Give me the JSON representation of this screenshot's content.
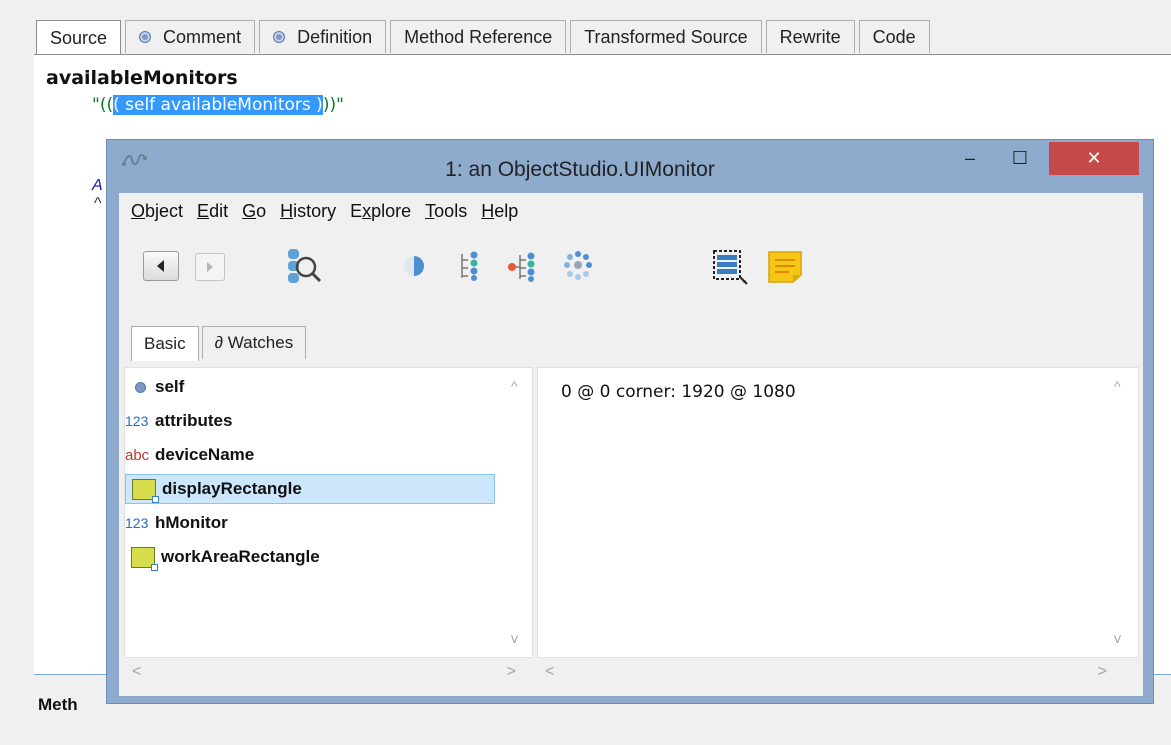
{
  "background_browser": {
    "tabs": [
      {
        "label": "Source",
        "dot": false,
        "active": true
      },
      {
        "label": "Comment",
        "dot": true
      },
      {
        "label": "Definition",
        "dot": true
      },
      {
        "label": "Method Reference",
        "dot": false
      },
      {
        "label": "Transformed Source",
        "dot": false
      },
      {
        "label": "Rewrite",
        "dot": false
      },
      {
        "label": "Code",
        "dot": false
      }
    ],
    "code": {
      "selector": "availableMonitors",
      "comment_prefix": "\"((",
      "comment_selected": "( self availableMonitors )",
      "comment_suffix": "))\"",
      "fragment_a": "A",
      "fragment_b": "^"
    },
    "bottom_label": "Meth"
  },
  "inspector": {
    "title": "1: an ObjectStudio.UIMonitor",
    "window_buttons": {
      "minimize": "–",
      "maximize": "☐",
      "close": "✕"
    },
    "menu": [
      {
        "pre": "",
        "u": "O",
        "post": "bject"
      },
      {
        "pre": "",
        "u": "E",
        "post": "dit"
      },
      {
        "pre": "",
        "u": "G",
        "post": "o"
      },
      {
        "pre": "",
        "u": "H",
        "post": "istory"
      },
      {
        "pre": "E",
        "u": "x",
        "post": "plore"
      },
      {
        "pre": "",
        "u": "T",
        "post": "ools"
      },
      {
        "pre": "",
        "u": "H",
        "post": "elp"
      }
    ],
    "toolbar_icons": [
      "back-icon",
      "forward-icon",
      "inspect-magnifier-icon",
      "half-circle-icon",
      "tree-structure-icon",
      "tree-expand-icon",
      "dots-grid-icon",
      "list-select-icon",
      "sticky-note-icon"
    ],
    "subtabs": [
      "Basic",
      "∂ Watches"
    ],
    "fields": [
      {
        "icon": "object",
        "icon_text": "",
        "name": "self",
        "selected": false
      },
      {
        "icon": "number",
        "icon_text": "123",
        "name": "attributes",
        "selected": false
      },
      {
        "icon": "string",
        "icon_text": "abc",
        "name": "deviceName",
        "selected": false
      },
      {
        "icon": "rectangle",
        "icon_text": "",
        "name": "displayRectangle",
        "selected": true
      },
      {
        "icon": "number",
        "icon_text": "123",
        "name": "hMonitor",
        "selected": false
      },
      {
        "icon": "rectangle",
        "icon_text": "",
        "name": "workAreaRectangle",
        "selected": false
      }
    ],
    "value_text": "0 @ 0 corner: 1920 @ 1080",
    "scroll_glyphs": {
      "up": "^",
      "down": "v",
      "left": "<",
      "right": ">"
    }
  },
  "colors": {
    "window_frame": "#8eabcd",
    "close_button": "#c74a4a",
    "selection": "#3399ff",
    "selected_row": "#cce6fb",
    "comment_text": "#0a7a23"
  }
}
